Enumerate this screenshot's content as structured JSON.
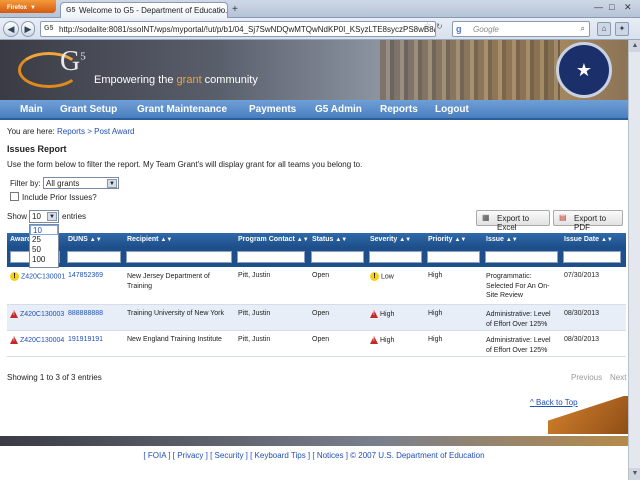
{
  "browser": {
    "app_button": "Firefox",
    "tab_title": "Welcome to G5 - Department of Educatio...",
    "url": "http://sodalite:8081/ssoINT/wps/myportal/!ut/p/b1/04_Sj7SwNDQwMTQwNdKP0I_KSyzLTE8syczPS8wB8aPl",
    "search_placeholder": "Google"
  },
  "banner": {
    "logo": "G",
    "logo_sup": "5",
    "tagline_pre": "Empowering the ",
    "tagline_em": "grant",
    "tagline_post": " community"
  },
  "menu": [
    "Main",
    "Grant Setup",
    "Grant Maintenance",
    "Payments",
    "G5 Admin",
    "Reports",
    "Logout"
  ],
  "breadcrumb": {
    "prefix": "You are here:",
    "path": "Reports > Post Award"
  },
  "page": {
    "title": "Issues Report",
    "description": "Use the form below to filter the report. My Team Grant's will display grant for all teams you belong to."
  },
  "filter": {
    "label": "Filter by:",
    "value": "All grants",
    "include_prior_label": "Include Prior Issues?"
  },
  "entries": {
    "show_label": "Show",
    "value": "10",
    "suffix": "entries",
    "options": [
      "10",
      "25",
      "50",
      "100"
    ]
  },
  "export": {
    "excel": "Export to Excel",
    "pdf": "Export to PDF"
  },
  "table": {
    "columns": [
      "Award",
      "DUNS",
      "Recipient",
      "Program Contact",
      "Status",
      "Severity",
      "Priority",
      "Issue",
      "Issue Date"
    ],
    "rows": [
      {
        "award": "Z420C130001",
        "duns": "147852369",
        "recipient": "New Jersey Department of Training",
        "contact": "Pitt, Justin",
        "status": "Open",
        "severity": "Low",
        "priority": "High",
        "issue": "Programmatic: Selected For An On-Site Review",
        "date": "07/30/2013"
      },
      {
        "award": "Z420C130003",
        "duns": "888888888",
        "recipient": "Training University of New York",
        "contact": "Pitt, Justin",
        "status": "Open",
        "severity": "High",
        "priority": "High",
        "issue": "Administrative: Level of Effort Over 125%",
        "date": "08/30/2013"
      },
      {
        "award": "Z420C130004",
        "duns": "191919191",
        "recipient": "New England Training Institute",
        "contact": "Pitt, Justin",
        "status": "Open",
        "severity": "High",
        "priority": "High",
        "issue": "Administrative: Level of Effort Over 125%",
        "date": "08/30/2013"
      }
    ]
  },
  "pagination": {
    "info": "Showing 1 to 3 of 3 entries",
    "previous": "Previous",
    "next": "Next"
  },
  "back_to_top": "^ Back to Top",
  "footer": "[ FOIA ] [ Privacy ] [ Security ] [ Keyboard Tips ] [ Notices ] © 2007 U.S. Department of Education"
}
